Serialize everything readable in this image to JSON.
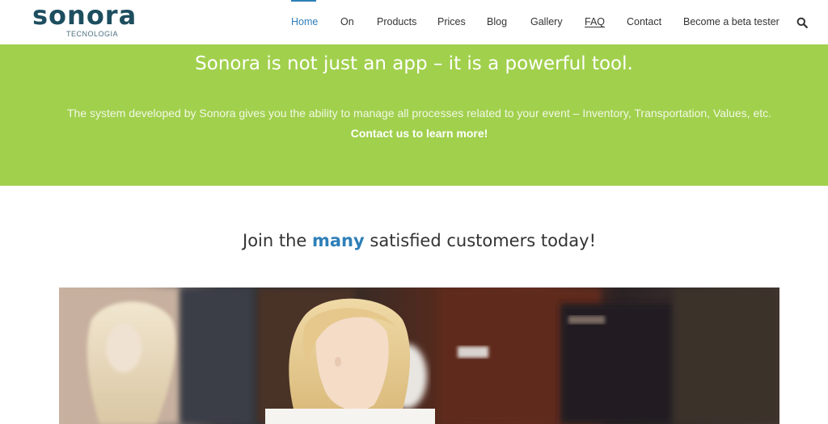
{
  "logo": {
    "word": "sonora",
    "sub": "TECNOLOGIA"
  },
  "nav": {
    "items": [
      {
        "label": "Home"
      },
      {
        "label": "On"
      },
      {
        "label": "Products"
      },
      {
        "label": "Prices"
      },
      {
        "label": "Blog"
      },
      {
        "label": "Gallery"
      },
      {
        "label": "FAQ"
      },
      {
        "label": "Contact"
      },
      {
        "label": "Become a beta tester"
      }
    ],
    "active_index": 0,
    "search_icon": "search-icon"
  },
  "hero": {
    "title": "Sonora is not just an app – it is a powerful tool.",
    "description": "The system developed by Sonora gives you the ability to manage all processes related to your event – Inventory, Transportation, Values, etc.",
    "cta": "Contact us to learn more!"
  },
  "join": {
    "before": "Join the ",
    "accent": "many",
    "after": " satisfied customers today!"
  },
  "colors": {
    "brand_dark": "#1d4e5f",
    "accent_blue": "#2e7fb8",
    "hero_green": "#a1d04d"
  }
}
